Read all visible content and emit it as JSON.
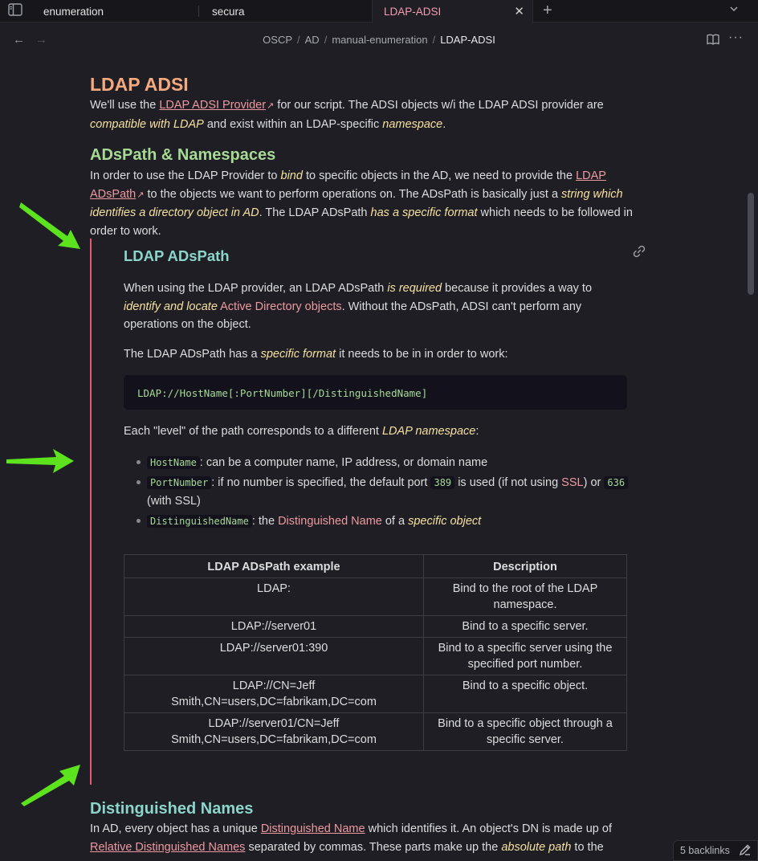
{
  "tabs": [
    {
      "label": "enumeration"
    },
    {
      "label": "secura"
    },
    {
      "label": "LDAP-ADSI"
    }
  ],
  "breadcrumb": [
    "OSCP",
    "AD",
    "manual-enumeration",
    "LDAP-ADSI"
  ],
  "note": {
    "title": "LDAP ADSI",
    "intro": {
      "t1": "We'll use the ",
      "link1": "LDAP ADSI Provider",
      "t2": " for our script. The ADSI objects w/i the LDAP ADSI provider are ",
      "em1": "compatible with LDAP",
      "t3": " and exist within an LDAP-specific ",
      "em2": "namespace",
      "t4": "."
    },
    "section1": {
      "heading": "ADsPath & Namespaces",
      "t1": "In order to use the LDAP Provider to ",
      "em1": "bind",
      "t2": " to specific objects in the AD, we need to provide the ",
      "link1": "LDAP ADsPath",
      "t3": " to the objects we want to perform operations on. The ADsPath is basically just a ",
      "em2": "string which identifies a directory object in AD",
      "t4": ". The LDAP ADsPath ",
      "em3": "has a specific format",
      "t5": " which needs to be followed in order to work."
    },
    "embed": {
      "title": "LDAP ADsPath",
      "p1": {
        "t1": "When using the LDAP provider, an LDAP ADsPath ",
        "em1": "is required",
        "t2": " because it provides a way to ",
        "em2": "identify and locate",
        "t3": " ",
        "pink1": "Active Directory objects",
        "t4": ". Without the ADsPath, ADSI can't perform any operations on the object."
      },
      "p2": {
        "t1": "The LDAP ADsPath has a ",
        "em1": "specific format",
        "t2": " it needs to be in in order to work:"
      },
      "code": "LDAP://HostName[:PortNumber][/DistinguishedName]",
      "p3": {
        "t1": "Each \"level\" of the path corresponds to a different ",
        "em1": "LDAP namespace",
        "t2": ":"
      },
      "bullets": {
        "b1": {
          "code": "HostName",
          "text": ": can be a computer name, IP address, or domain name"
        },
        "b2": {
          "code": "PortNumber",
          "t1": ": if no number is specified, the default port ",
          "code2": "389",
          "t2": " is used (if not using ",
          "pink": "SSL",
          "t3": ") or ",
          "code3": "636",
          "t4": " (with SSL)"
        },
        "b3": {
          "code": "DistinguishedName",
          "t1": ": the ",
          "pink": "Distinguished Name",
          "t2": " of a ",
          "em": "specific object"
        }
      },
      "table": {
        "headers": [
          "LDAP ADsPath example",
          "Description"
        ],
        "rows": [
          [
            "LDAP:",
            "Bind to the root of the LDAP namespace."
          ],
          [
            "LDAP://server01",
            "Bind to a specific server."
          ],
          [
            "LDAP://server01:390",
            "Bind to a specific server using the specified port number."
          ],
          [
            "LDAP://CN=Jeff Smith,CN=users,DC=fabrikam,DC=com",
            "Bind to a specific object."
          ],
          [
            "LDAP://server01/CN=Jeff Smith,CN=users,DC=fabrikam,DC=com",
            "Bind to a specific object through a specific server."
          ]
        ]
      }
    },
    "section2": {
      "heading": "Distinguished Names",
      "t1": "In AD, every object has a unique ",
      "link1": "Distinguished Name",
      "t2": " which identifies it. An object's DN is made up of ",
      "link2": "Relative Distinguished Names",
      "t3": " separated by commas. These parts make up the ",
      "em1": "absolute path",
      "t4": " to the"
    }
  },
  "status": {
    "backlinks": "5 backlinks"
  },
  "colors": {
    "accent": "#e8566f",
    "heading": "#f5a97f",
    "subheading": "#a6da95",
    "embed_title": "#8bd5ca",
    "link": "#ee99a0",
    "emphasis": "#f5e0a0",
    "arrow": "#5de31e"
  }
}
